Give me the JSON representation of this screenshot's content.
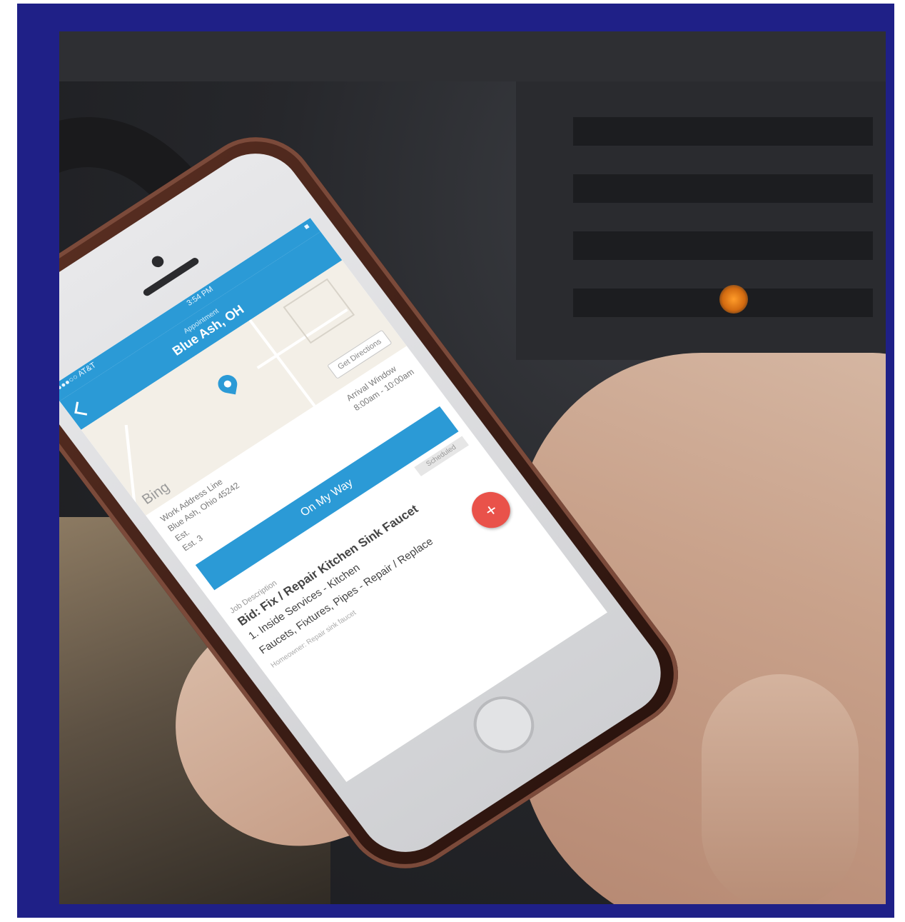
{
  "status_bar": {
    "carrier": "●●●○○ AT&T",
    "time": "3:54 PM",
    "battery": "■"
  },
  "nav": {
    "subtitle": "Appointment",
    "title": "Blue Ash, OH"
  },
  "map": {
    "directions_button": "Get Directions",
    "logo": "Bing"
  },
  "details": {
    "address_label": "Work Address Line",
    "address_value": "Blue Ash, Ohio 45242",
    "arrival_label": "Arrival Window",
    "arrival_value": "8:00am - 10:00am",
    "est_label": "Est.",
    "est_value": "Est. 3"
  },
  "primary_button": {
    "label": "On My Way"
  },
  "chip": {
    "label": "Scheduled"
  },
  "job": {
    "section_label": "Job Description",
    "title": "Bid: Fix / Repair Kitchen Sink Faucet",
    "lines": [
      "1. Inside Services - Kitchen",
      "Faucets, Fixtures, Pipes - Repair / Replace"
    ],
    "footnote": "Homeowner: Repair sink faucet"
  },
  "fab": {
    "icon": "plus-icon",
    "label": "+"
  },
  "colors": {
    "frame": "#1f2087",
    "app_blue": "#2b9ad6",
    "fab_red": "#e9524a"
  }
}
